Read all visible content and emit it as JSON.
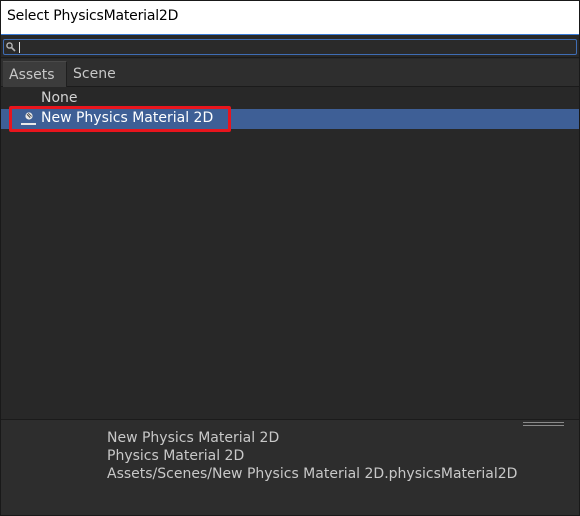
{
  "window": {
    "title": "Select PhysicsMaterial2D"
  },
  "search": {
    "value": "",
    "placeholder": ""
  },
  "tabs": [
    {
      "label": "Assets",
      "active": true
    },
    {
      "label": "Scene",
      "active": false
    }
  ],
  "list": {
    "items": [
      {
        "label": "None",
        "selected": false,
        "icon": "none"
      },
      {
        "label": "New Physics Material 2D",
        "selected": true,
        "icon": "physics-material-2d-icon"
      }
    ]
  },
  "details": {
    "name": "New Physics Material 2D",
    "type": "Physics Material 2D",
    "path": "Assets/Scenes/New Physics Material 2D.physicsMaterial2D"
  },
  "colors": {
    "background": "#282828",
    "selection": "#3e5f96",
    "highlight_box": "#e8151d",
    "search_focus_border": "#3f6db4"
  }
}
